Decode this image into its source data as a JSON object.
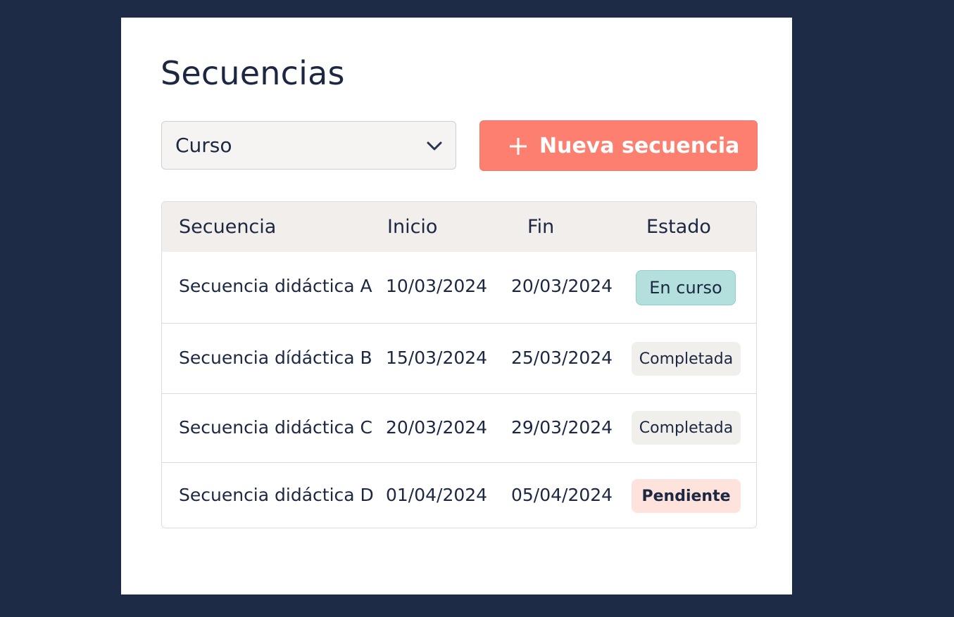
{
  "page": {
    "title": "Secuencias"
  },
  "filter": {
    "course_select": {
      "value": "Curso",
      "icon": "chevron-down-icon"
    }
  },
  "actions": {
    "new_sequence": {
      "label": "Nueva secuencia",
      "icon": "plus-icon",
      "color": "#fc7f70"
    }
  },
  "table": {
    "columns": [
      "Secuencia",
      "Inicio",
      "Fin",
      "Estado"
    ],
    "rows": [
      {
        "name": "Secuencia didáctica A",
        "start": "10/03/2024",
        "end": "20/03/2024",
        "status": "En curso",
        "status_type": "progress"
      },
      {
        "name": "Secuencia dídáctica B",
        "start": "15/03/2024",
        "end": "25/03/2024",
        "status": "Completada",
        "status_type": "done"
      },
      {
        "name": "Secuencia didáctica C",
        "start": "20/03/2024",
        "end": "29/03/2024",
        "status": "Completada",
        "status_type": "done"
      },
      {
        "name": "Secuencia didáctica D",
        "start": "01/04/2024",
        "end": "05/04/2024",
        "status": "Pendiente",
        "status_type": "pending"
      }
    ]
  },
  "colors": {
    "background": "#1d2b47",
    "text": "#1c2742",
    "status_progress": "#b3dfdc",
    "status_done": "#f1efec",
    "status_pending": "#fde3dc"
  }
}
